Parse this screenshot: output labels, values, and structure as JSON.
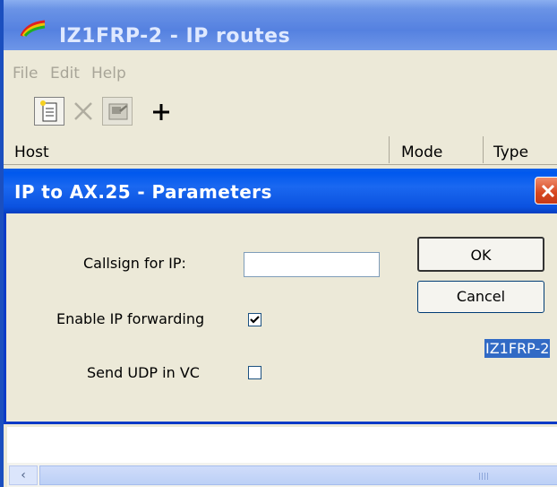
{
  "main_window": {
    "title": "IZ1FRP-2 - IP routes",
    "menu": [
      "File",
      "Edit",
      "Help"
    ],
    "toolbar": {
      "new_icon": "new-document-icon",
      "delete_icon": "delete-icon",
      "properties_icon": "properties-icon",
      "add_icon": "plus-icon",
      "add_label": "+"
    },
    "columns": [
      "Host",
      "Mode",
      "Type"
    ]
  },
  "dialog": {
    "title": "IP to AX.25 - Parameters",
    "callsign_label": "Callsign for IP:",
    "callsign_value": "IZ1FRP-2",
    "enable_forwarding_label": "Enable IP forwarding",
    "enable_forwarding_checked": true,
    "send_udp_label": "Send UDP in VC",
    "send_udp_checked": false,
    "ok_label": "OK",
    "cancel_label": "Cancel"
  },
  "scrollbar": {
    "left_arrow": "‹"
  },
  "colors": {
    "titlebar_active": "#0058ee",
    "titlebar_inactive": "#6a93e6",
    "window_face": "#ece9d8",
    "close_button": "#d6461f",
    "selection": "#316ac5"
  }
}
